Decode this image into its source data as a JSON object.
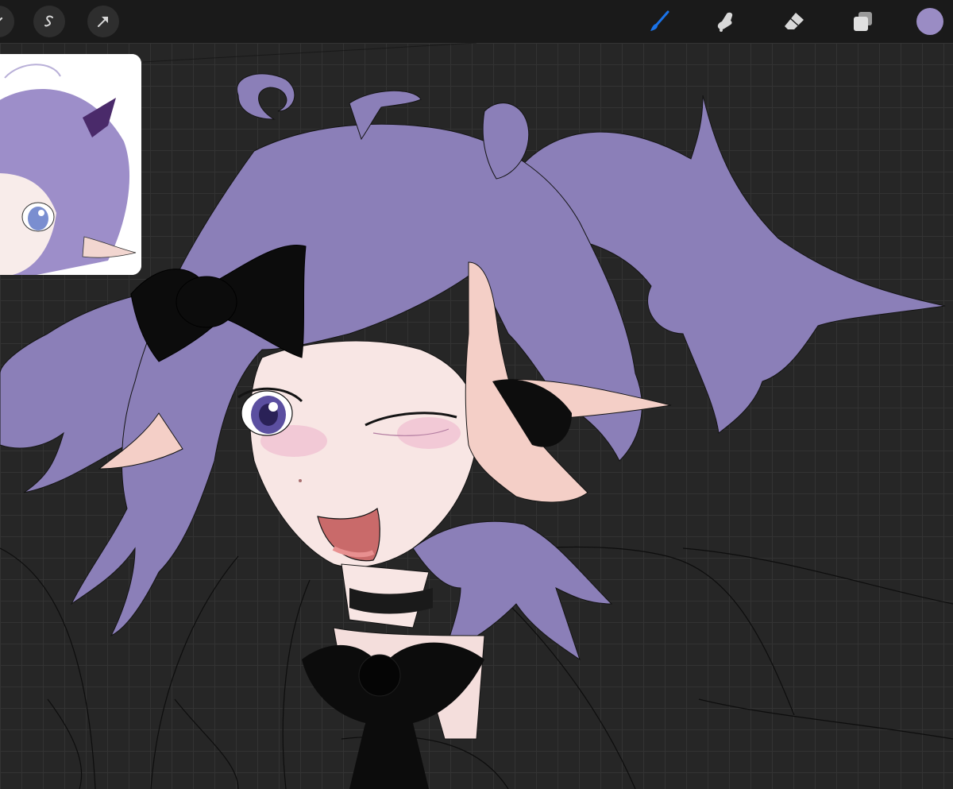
{
  "app": {
    "name": "drawing-app"
  },
  "toolbar": {
    "left_tools": [
      {
        "name": "adjustments",
        "icon": "magic-wand-icon"
      },
      {
        "name": "selection",
        "icon": "selection-s-icon",
        "glyph": "S"
      },
      {
        "name": "transform",
        "icon": "arrow-cursor-icon"
      }
    ],
    "right_tools": [
      {
        "name": "brush",
        "icon": "brush-icon",
        "active": true
      },
      {
        "name": "smudge",
        "icon": "smudge-finger-icon",
        "active": false
      },
      {
        "name": "eraser",
        "icon": "eraser-icon",
        "active": false
      },
      {
        "name": "layers",
        "icon": "layers-icon",
        "active": false
      }
    ],
    "current_color": "#9a8cc4"
  },
  "colors": {
    "toolbar_bg": "#1a1a1a",
    "canvas_bg": "#262626",
    "accent_active": "#1a73e8",
    "icon": "#d8d8d8",
    "hair": "#8b7fb8",
    "skin": "#f8e6e4",
    "lineart": "#111111"
  }
}
